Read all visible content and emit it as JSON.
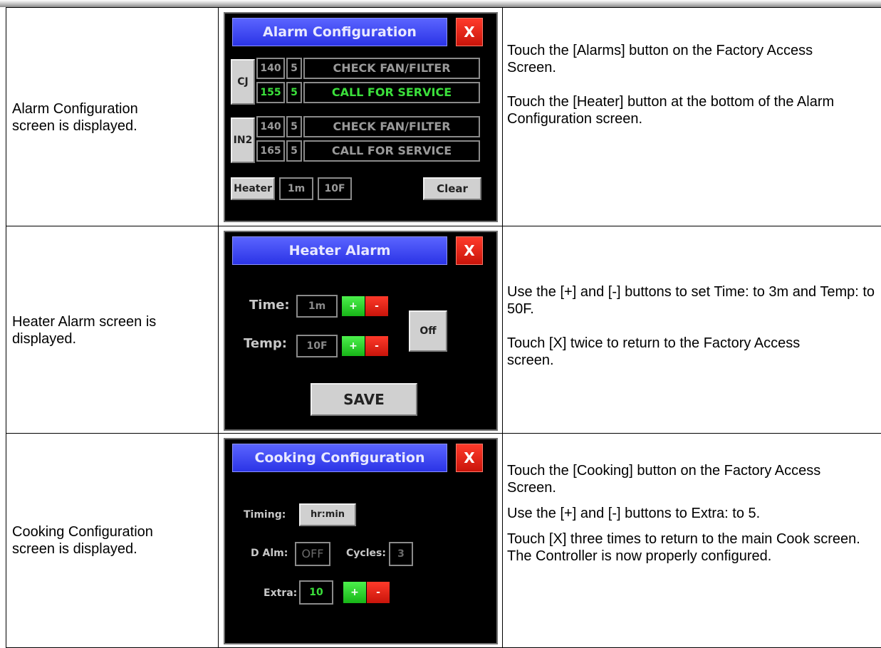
{
  "rows": [
    {
      "description": "Alarm Configuration screen is displayed.",
      "instructions": [
        "Touch the [Alarms] button on the Factory Access Screen.",
        "Touch the [Heater] button at the bottom of the Alarm Configuration screen."
      ],
      "screen": {
        "title": "Alarm Configuration",
        "close_label": "X",
        "groups": [
          {
            "label": "CJ",
            "rows": [
              {
                "temp": "140",
                "time": "5",
                "message": "CHECK FAN/FILTER",
                "active": false
              },
              {
                "temp": "155",
                "time": "5",
                "message": "CALL FOR SERVICE",
                "active": true
              }
            ]
          },
          {
            "label": "IN2",
            "rows": [
              {
                "temp": "140",
                "time": "5",
                "message": "CHECK FAN/FILTER",
                "active": false
              },
              {
                "temp": "165",
                "time": "5",
                "message": "CALL FOR SERVICE",
                "active": false
              }
            ]
          }
        ],
        "heater_label": "Heater",
        "heater_time": "1m",
        "heater_temp": "10F",
        "clear_label": "Clear"
      }
    },
    {
      "description": "Heater Alarm screen is displayed.",
      "instructions": [
        "Use the [+] and [-] buttons to set Time: to 3m and Temp: to 50F.",
        "Touch [X] twice to return to the Factory Access screen."
      ],
      "screen": {
        "title": "Heater Alarm",
        "close_label": "X",
        "time_label": "Time:",
        "time_value": "1m",
        "temp_label": "Temp:",
        "temp_value": "10F",
        "plus_label": "+",
        "minus_label": "-",
        "off_label": "Off",
        "save_label": "SAVE"
      }
    },
    {
      "description": "Cooking Configuration screen is displayed.",
      "instructions": [
        "Touch the [Cooking] button on the Factory Access Screen.",
        "Use the [+] and [-] buttons to Extra: to 5.",
        "Touch [X] three times to return to the main Cook screen.  The Controller is now properly configured."
      ],
      "screen": {
        "title": "Cooking Configuration",
        "close_label": "X",
        "timing_label": "Timing:",
        "timing_value": "hr:min",
        "dalm_label": "D Alm:",
        "dalm_value": "OFF",
        "cycles_label": "Cycles:",
        "cycles_value": "3",
        "extra_label": "Extra:",
        "extra_value": "10",
        "plus_label": "+",
        "minus_label": "-"
      }
    }
  ]
}
